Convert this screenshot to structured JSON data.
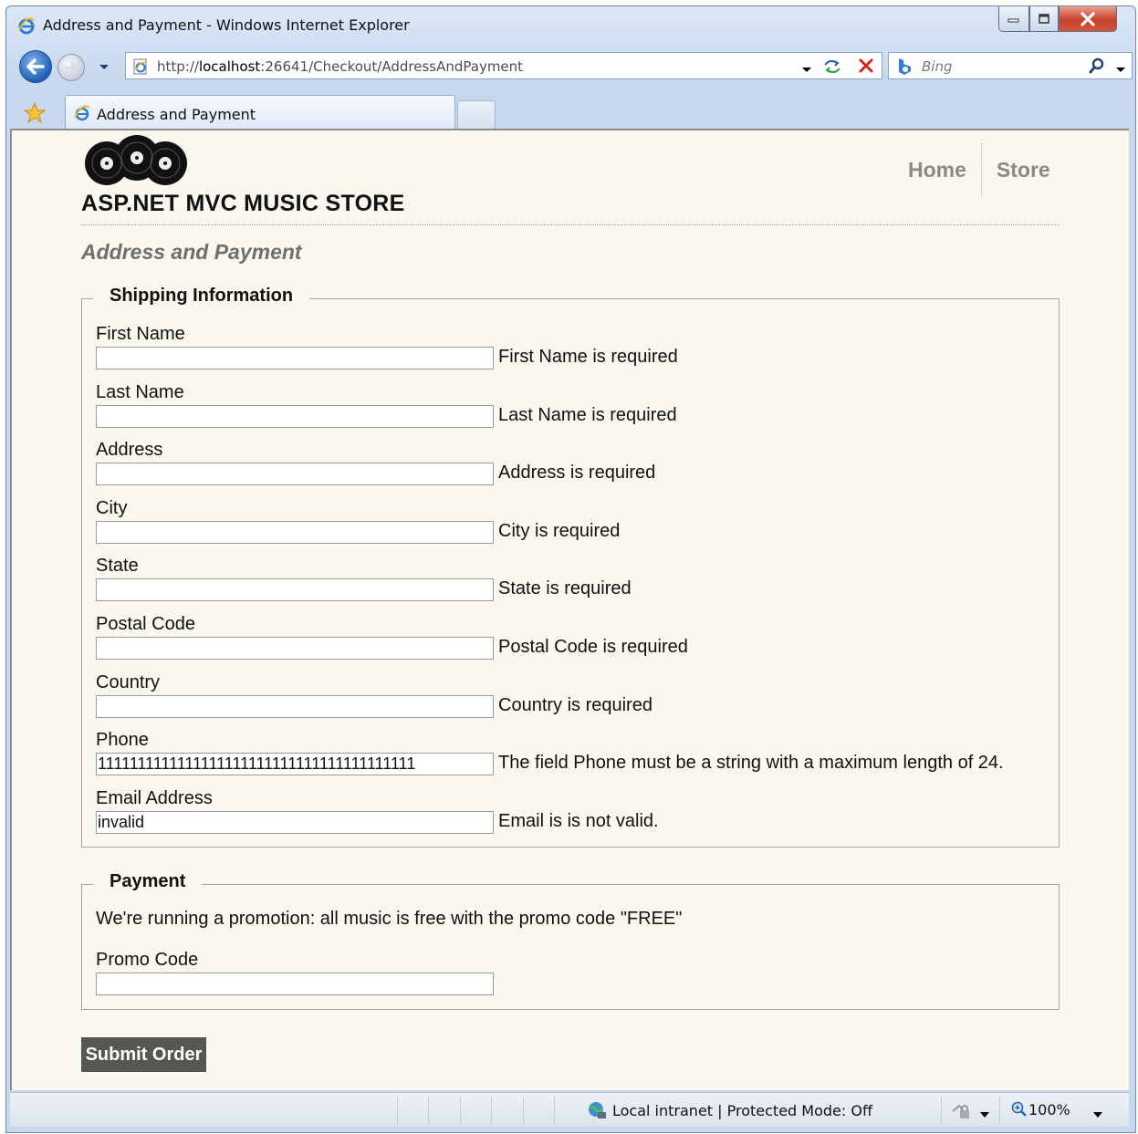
{
  "browser": {
    "window_title": "Address and Payment - Windows Internet Explorer",
    "url_prefix": "http://",
    "url_host": "localhost",
    "url_rest": ":26641/Checkout/AddressAndPayment",
    "search_placeholder": "Bing",
    "tab_label": "Address and Payment",
    "status_zone": "Local intranet | Protected Mode: Off",
    "zoom": "100%"
  },
  "site": {
    "title": "ASP.NET MVC MUSIC STORE",
    "nav": [
      "Home",
      "Store"
    ],
    "page_heading": "Address and Payment"
  },
  "shipping": {
    "legend": "Shipping Information",
    "fields": [
      {
        "label": "First Name",
        "value": "",
        "error": "First Name is required"
      },
      {
        "label": "Last Name",
        "value": "",
        "error": "Last Name is required"
      },
      {
        "label": "Address",
        "value": "",
        "error": "Address is required"
      },
      {
        "label": "City",
        "value": "",
        "error": "City is required"
      },
      {
        "label": "State",
        "value": "",
        "error": "State is required"
      },
      {
        "label": "Postal Code",
        "value": "",
        "error": "Postal Code is required"
      },
      {
        "label": "Country",
        "value": "",
        "error": "Country is required"
      },
      {
        "label": "Phone",
        "value": "1111111111111111111111111111111111111111",
        "error": "The field Phone must be a string with a maximum length of 24."
      },
      {
        "label": "Email Address",
        "value": "invalid",
        "error": "Email is is not valid."
      }
    ]
  },
  "payment": {
    "legend": "Payment",
    "promo_text": "We're running a promotion: all music is free with the promo code \"FREE\"",
    "promo_label": "Promo Code",
    "promo_value": ""
  },
  "submit_label": "Submit Order"
}
